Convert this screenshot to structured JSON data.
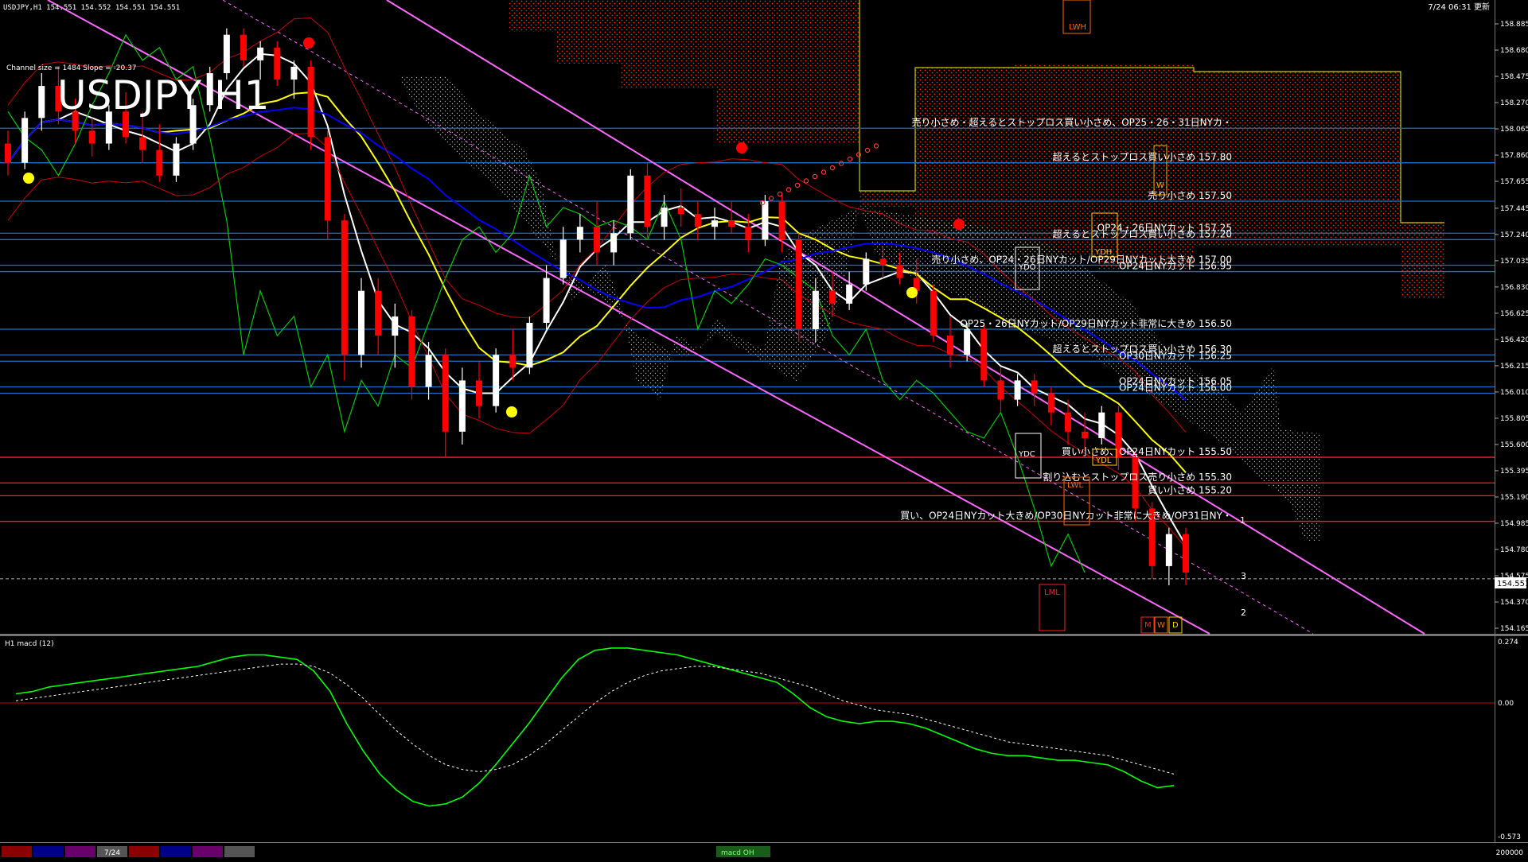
{
  "header": {
    "symbol_line": "USDJPY,H1  154.551 154.552 154.551 154.551",
    "channel_info": "Channel size = 1484 Slope = -20.37",
    "big_title": "USDJPY H1",
    "datetime": "7/24 06:31 更新"
  },
  "colors": {
    "background": "#000000",
    "bull_candle": "#ffffff",
    "bear_candle": "#ff0000",
    "ma_white": "#ffffff",
    "ma_yellow": "#ffff00",
    "ma_blue": "#0000ff",
    "channel_line": "#ff66ff",
    "level_blue": "#1e6fc9",
    "level_red": "#ff2020",
    "kumo_red": "#ff2a00",
    "macd_line": "#00ff00",
    "macd_signal": "#ffffff"
  },
  "price_axis": {
    "ticks": [
      "158.885",
      "158.680",
      "158.475",
      "158.270",
      "158.065",
      "157.860",
      "157.655",
      "157.445",
      "157.240",
      "157.035",
      "156.830",
      "156.625",
      "156.420",
      "156.215",
      "156.010",
      "155.805",
      "155.600",
      "155.395",
      "155.190",
      "154.985",
      "154.780",
      "154.575",
      "154.370",
      "154.165"
    ],
    "current_price": "154.551"
  },
  "macd_panel": {
    "label": "H1 macd (12)",
    "ticks": [
      "0.274",
      "0.00",
      "-0.573"
    ]
  },
  "annotations": [
    {
      "text": "売り小さめ・超えるとストップロス買い小さめ、OP25・26・31日NYカ・",
      "price": 158.07
    },
    {
      "text": "超えるとストップロス買い小さめ 157.80",
      "price": 157.8
    },
    {
      "text": "売り小さめ 157.50",
      "price": 157.5
    },
    {
      "text": "OP24・26日NYカット 157.25",
      "price": 157.25
    },
    {
      "text": "超えるとストップロス買い小さめ 157.20",
      "price": 157.2
    },
    {
      "text": "売り小さめ、OP24・26日NYカット/OP29日NYカット大きめ 157.00",
      "price": 157.0
    },
    {
      "text": "OP24日NYカット 156.95",
      "price": 156.95
    },
    {
      "text": "OP25・26日NYカット/OP29日NYカット非常に大きめ 156.50",
      "price": 156.5
    },
    {
      "text": "超えるとストップロス買い小さめ 156.30",
      "price": 156.3
    },
    {
      "text": "OP30日NYカット 156.25",
      "price": 156.25
    },
    {
      "text": "OP24日NYカット 156.05",
      "price": 156.05
    },
    {
      "text": "OP24日NYカット 156.00",
      "price": 156.0
    },
    {
      "text": "買い小さめ、OP24日NYカット 155.50",
      "price": 155.5
    },
    {
      "text": "割り込むとストップロス売り小さめ 155.30",
      "price": 155.3
    },
    {
      "text": "買い小さめ 155.20",
      "price": 155.2
    },
    {
      "text": "買い、OP24日NYカット大きめ/OP30日NYカット非常に大きめ/OP31日NY・",
      "price": 155.0
    }
  ],
  "box_labels": [
    {
      "text": "LWH"
    },
    {
      "text": "W"
    },
    {
      "text": "YDH"
    },
    {
      "text": "YDO"
    },
    {
      "text": "YDC"
    },
    {
      "text": "YDL"
    },
    {
      "text": "LWL"
    },
    {
      "text": "LML"
    },
    {
      "text": "M"
    },
    {
      "text": "W"
    },
    {
      "text": "D"
    }
  ],
  "channel_marks": [
    "1",
    "3",
    "2"
  ],
  "bottom_tabs": [
    {
      "label": "",
      "color": "#8b0000"
    },
    {
      "label": "",
      "color": "#00008b"
    },
    {
      "label": "",
      "color": "#6a006a"
    },
    {
      "label": "7/24",
      "color": "#555555"
    },
    {
      "label": "",
      "color": "#8b0000"
    },
    {
      "label": "",
      "color": "#00008b"
    },
    {
      "label": "",
      "color": "#6a006a"
    },
    {
      "label": "",
      "color": "#555555"
    }
  ],
  "status_bar": {
    "center_label": "macd OH",
    "right_label": "200000"
  },
  "chart_data": {
    "type": "candlestick",
    "title": "USDJPY H1",
    "ylim": [
      154.1,
      158.95
    ],
    "candles": [
      [
        157.95,
        158.05,
        157.7,
        157.8
      ],
      [
        157.8,
        158.2,
        157.75,
        158.15
      ],
      [
        158.15,
        158.5,
        158.05,
        158.4
      ],
      [
        158.4,
        158.55,
        158.1,
        158.2
      ],
      [
        158.2,
        158.3,
        157.95,
        158.05
      ],
      [
        158.05,
        158.15,
        157.85,
        157.95
      ],
      [
        157.95,
        158.25,
        157.9,
        158.2
      ],
      [
        158.2,
        158.35,
        157.95,
        158.0
      ],
      [
        158.0,
        158.2,
        157.8,
        157.9
      ],
      [
        157.9,
        158.1,
        157.65,
        157.7
      ],
      [
        157.7,
        158.0,
        157.65,
        157.95
      ],
      [
        157.95,
        158.3,
        157.9,
        158.25
      ],
      [
        158.25,
        158.55,
        158.2,
        158.5
      ],
      [
        158.5,
        158.85,
        158.45,
        158.8
      ],
      [
        158.8,
        158.85,
        158.55,
        158.6
      ],
      [
        158.6,
        158.75,
        158.45,
        158.7
      ],
      [
        158.7,
        158.75,
        158.4,
        158.45
      ],
      [
        158.45,
        158.6,
        158.3,
        158.55
      ],
      [
        158.55,
        158.6,
        157.9,
        158.0
      ],
      [
        158.0,
        158.05,
        157.2,
        157.35
      ],
      [
        157.35,
        157.4,
        156.1,
        156.3
      ],
      [
        156.3,
        156.9,
        156.2,
        156.8
      ],
      [
        156.8,
        156.9,
        156.3,
        156.45
      ],
      [
        156.45,
        156.7,
        156.2,
        156.6
      ],
      [
        156.6,
        156.65,
        155.95,
        156.05
      ],
      [
        156.05,
        156.4,
        155.95,
        156.3
      ],
      [
        156.3,
        156.35,
        155.5,
        155.7
      ],
      [
        155.7,
        156.2,
        155.6,
        156.1
      ],
      [
        156.1,
        156.25,
        155.8,
        155.9
      ],
      [
        155.9,
        156.35,
        155.85,
        156.3
      ],
      [
        156.3,
        156.5,
        156.1,
        156.2
      ],
      [
        156.2,
        156.6,
        156.15,
        156.55
      ],
      [
        156.55,
        157.0,
        156.5,
        156.9
      ],
      [
        156.9,
        157.3,
        156.85,
        157.2
      ],
      [
        157.2,
        157.4,
        157.1,
        157.3
      ],
      [
        157.3,
        157.5,
        157.0,
        157.1
      ],
      [
        157.1,
        157.35,
        157.0,
        157.25
      ],
      [
        157.25,
        157.75,
        157.2,
        157.7
      ],
      [
        157.7,
        157.8,
        157.2,
        157.3
      ],
      [
        157.3,
        157.55,
        157.2,
        157.45
      ],
      [
        157.45,
        157.6,
        157.3,
        157.4
      ],
      [
        157.4,
        157.5,
        157.2,
        157.3
      ],
      [
        157.3,
        157.45,
        157.2,
        157.35
      ],
      [
        157.35,
        157.5,
        157.25,
        157.3
      ],
      [
        157.3,
        157.4,
        157.1,
        157.2
      ],
      [
        157.2,
        157.55,
        157.15,
        157.5
      ],
      [
        157.5,
        157.55,
        157.1,
        157.2
      ],
      [
        157.2,
        157.25,
        156.4,
        156.5
      ],
      [
        156.5,
        156.9,
        156.4,
        156.8
      ],
      [
        156.8,
        156.95,
        156.6,
        156.7
      ],
      [
        156.7,
        156.95,
        156.65,
        156.85
      ],
      [
        156.85,
        157.1,
        156.8,
        157.05
      ],
      [
        157.05,
        157.15,
        156.9,
        157.0
      ],
      [
        157.0,
        157.1,
        156.85,
        156.9
      ],
      [
        156.9,
        157.05,
        156.7,
        156.8
      ],
      [
        156.8,
        156.85,
        156.4,
        156.45
      ],
      [
        156.45,
        156.6,
        156.2,
        156.3
      ],
      [
        156.3,
        156.55,
        156.25,
        156.5
      ],
      [
        156.5,
        156.55,
        156.05,
        156.1
      ],
      [
        156.1,
        156.2,
        155.85,
        155.95
      ],
      [
        155.95,
        156.15,
        155.9,
        156.1
      ],
      [
        156.1,
        156.15,
        155.9,
        156.0
      ],
      [
        156.0,
        156.05,
        155.75,
        155.85
      ],
      [
        155.85,
        155.95,
        155.6,
        155.7
      ],
      [
        155.7,
        155.85,
        155.55,
        155.65
      ],
      [
        155.65,
        155.9,
        155.6,
        155.85
      ],
      [
        155.85,
        155.9,
        155.4,
        155.5
      ],
      [
        155.5,
        155.55,
        155.0,
        155.1
      ],
      [
        155.1,
        155.15,
        154.55,
        154.65
      ],
      [
        154.65,
        154.95,
        154.5,
        154.9
      ],
      [
        154.9,
        154.95,
        154.5,
        154.6
      ]
    ],
    "macd": [
      0.05,
      0.06,
      0.08,
      0.09,
      0.1,
      0.11,
      0.12,
      0.13,
      0.14,
      0.15,
      0.16,
      0.17,
      0.19,
      0.21,
      0.22,
      0.22,
      0.21,
      0.2,
      0.15,
      0.06,
      -0.08,
      -0.2,
      -0.3,
      -0.37,
      -0.42,
      -0.44,
      -0.43,
      -0.4,
      -0.34,
      -0.26,
      -0.17,
      -0.08,
      0.02,
      0.12,
      0.2,
      0.24,
      0.25,
      0.25,
      0.24,
      0.23,
      0.22,
      0.2,
      0.18,
      0.16,
      0.14,
      0.12,
      0.1,
      0.05,
      -0.01,
      -0.05,
      -0.07,
      -0.08,
      -0.07,
      -0.07,
      -0.08,
      -0.1,
      -0.13,
      -0.16,
      -0.19,
      -0.21,
      -0.22,
      -0.22,
      -0.23,
      -0.24,
      -0.24,
      -0.25,
      -0.26,
      -0.29,
      -0.33,
      -0.36,
      -0.35
    ],
    "macd_signal": [
      0.02,
      0.03,
      0.04,
      0.05,
      0.06,
      0.07,
      0.08,
      0.09,
      0.1,
      0.11,
      0.12,
      0.13,
      0.14,
      0.15,
      0.16,
      0.17,
      0.18,
      0.18,
      0.17,
      0.14,
      0.09,
      0.03,
      -0.04,
      -0.11,
      -0.17,
      -0.22,
      -0.26,
      -0.28,
      -0.29,
      -0.28,
      -0.26,
      -0.22,
      -0.17,
      -0.11,
      -0.05,
      0.01,
      0.06,
      0.1,
      0.13,
      0.15,
      0.16,
      0.17,
      0.17,
      0.16,
      0.15,
      0.14,
      0.12,
      0.1,
      0.08,
      0.05,
      0.02,
      0.0,
      -0.02,
      -0.03,
      -0.04,
      -0.06,
      -0.08,
      -0.1,
      -0.12,
      -0.14,
      -0.16,
      -0.17,
      -0.18,
      -0.19,
      -0.2,
      -0.21,
      -0.22,
      -0.24,
      -0.26,
      -0.28,
      -0.3
    ]
  }
}
